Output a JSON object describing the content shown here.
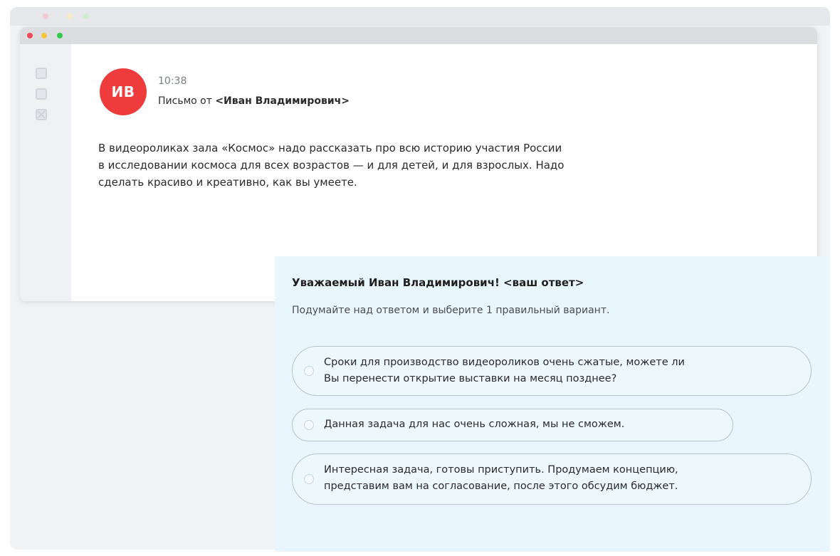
{
  "colors": {
    "avatar_bg": "#ee3b3b",
    "answer_panel_bg": "#e9f6fd",
    "window_dot_red": "#ee4a5a",
    "window_dot_yellow": "#f5c43a",
    "window_dot_green": "#34c94d"
  },
  "sidebar": {
    "icons": [
      "inbox-icon",
      "folder-icon",
      "trash-icon"
    ]
  },
  "mail": {
    "avatar_initials": "ИВ",
    "time": "10:38",
    "from_prefix": "Письмо от ",
    "from_name": "<Иван Владимирович>",
    "body_lines": [
      "В видеороликах зала «Космос» надо рассказать про всю историю участия России",
      "в исследовании космоса для всех возрастов — и для детей, и для взрослых. Надо",
      "сделать красиво и креативно, как вы умеете."
    ]
  },
  "answer": {
    "title": "Уважаемый Иван Владимирович! <ваш ответ>",
    "hint": "Подумайте над ответом и выберите 1 правильный вариант.",
    "options": [
      {
        "line1": "Сроки для производство видеороликов очень сжатые, можете ли",
        "line2": "Вы перенести открытие выставки на месяц позднее?"
      },
      {
        "line1": "Данная задача для нас очень сложная, мы не сможем.",
        "line2": ""
      },
      {
        "line1": "Интересная задача, готовы приступить. Продумаем концепцию,",
        "line2": "представим вам на согласование, после этого обсудим бюджет."
      }
    ]
  }
}
